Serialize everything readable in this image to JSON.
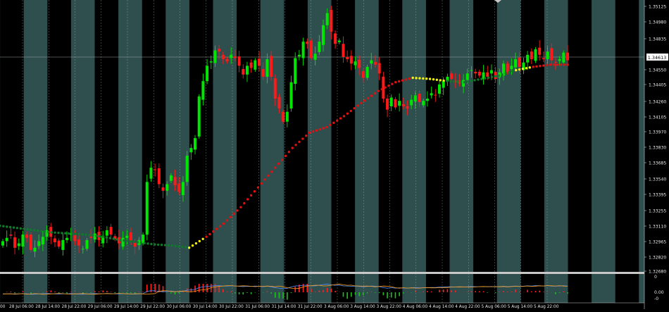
{
  "chart_data": [
    {
      "type": "candlestick",
      "panel": "price",
      "session_background_colors": [
        "#000000",
        "#2f4f4f"
      ],
      "up_color": "#00e600",
      "down_color": "#ff1a1a",
      "current_price": "1.34613",
      "y_ticks": [
        "1.35125",
        "1.34980",
        "1.34835",
        "1.34550",
        "1.34405",
        "1.34260",
        "1.34105",
        "1.33970",
        "1.33830",
        "1.33685",
        "1.33540",
        "1.33395",
        "1.33255",
        "1.33110",
        "1.32965",
        "1.32820",
        "1.32680"
      ],
      "ylim": [
        1.3268,
        1.3516
      ],
      "x_ticks": [
        "28 Jul 06:00",
        "28 Jul 14:00",
        "28 Jul 22:00",
        "29 Jul 06:00",
        "29 Jul 14:00",
        "29 Jul 22:00",
        "30 Jul 06:00",
        "30 Jul 14:00",
        "30 Jul 22:00",
        "31 Jul 06:00",
        "31 Jul 14:00",
        "31 Jul 22:00",
        "3 Aug 06:00",
        "3 Aug 14:00",
        "3 Aug 22:00",
        "4 Aug 06:00",
        "4 Aug 14:00",
        "4 Aug 22:00",
        "5 Aug 06:00",
        "5 Aug 14:00",
        "5 Aug 22:00"
      ],
      "x_tick_start_label": "00",
      "close_series": [
        1.3296,
        1.3299,
        1.3301,
        1.329,
        1.3294,
        1.3302,
        1.3299,
        1.3288,
        1.329,
        1.3296,
        1.33,
        1.3306,
        1.33,
        1.3295,
        1.3291,
        1.3297,
        1.3299,
        1.3303,
        1.3296,
        1.3292,
        1.3289,
        1.3297,
        1.3299,
        1.3303,
        1.3297,
        1.3301,
        1.3306,
        1.3302,
        1.3298,
        1.3294,
        1.3299,
        1.3301,
        1.3296,
        1.3291,
        1.3297,
        1.3302,
        1.335,
        1.3363,
        1.3361,
        1.3348,
        1.3342,
        1.3348,
        1.3356,
        1.3347,
        1.3341,
        1.335,
        1.3374,
        1.3381,
        1.339,
        1.3428,
        1.3442,
        1.3456,
        1.346,
        1.347,
        1.3469,
        1.3462,
        1.346,
        1.3466,
        1.3463,
        1.3456,
        1.3448,
        1.3456,
        1.3454,
        1.3461,
        1.3456,
        1.3446,
        1.3462,
        1.3446,
        1.3426,
        1.3417,
        1.3405,
        1.3414,
        1.3441,
        1.3463,
        1.3466,
        1.3478,
        1.3476,
        1.3463,
        1.3467,
        1.3478,
        1.3493,
        1.3504,
        1.3487,
        1.3476,
        1.3479,
        1.3464,
        1.3462,
        1.3458,
        1.346,
        1.3454,
        1.3445,
        1.3455,
        1.3461,
        1.3457,
        1.3449,
        1.3426,
        1.3416,
        1.3427,
        1.3418,
        1.3424,
        1.3419,
        1.3417,
        1.3425,
        1.3429,
        1.3423,
        1.3424,
        1.3426,
        1.3431,
        1.3429,
        1.3439,
        1.3442,
        1.3446,
        1.3444,
        1.3441,
        1.344,
        1.3443,
        1.3449,
        1.3452,
        1.3449,
        1.3447,
        1.345,
        1.3446,
        1.3452,
        1.3444,
        1.345,
        1.3458,
        1.345,
        1.3456,
        1.3462,
        1.3455,
        1.3459,
        1.3466,
        1.3462,
        1.3471,
        1.3466,
        1.3462,
        1.3469,
        1.3461,
        1.3459,
        1.3462,
        1.3468,
        1.3461
      ],
      "trend_series": [
        1.331,
        1.3308,
        1.3306,
        1.3304,
        1.3303,
        1.3302,
        1.33,
        1.3297,
        1.3295,
        1.3293,
        1.3292,
        1.329,
        1.33,
        1.3312,
        1.3327,
        1.3345,
        1.3363,
        1.3381,
        1.3395,
        1.34,
        1.341,
        1.3422,
        1.3433,
        1.3441,
        1.3445,
        1.3444,
        1.3442,
        1.3441,
        1.3444,
        1.3447,
        1.3452,
        1.3455,
        1.3457,
        1.3457
      ],
      "trend_colors_note": "bull phase red, bear phase green, neutral yellow"
    },
    {
      "type": "macd",
      "panel": "oscillator",
      "y_ticks": [
        "0",
        "0.00",
        "-0"
      ],
      "main_line_color": "#4f8fff",
      "signal_line_color": "#ff9f1a",
      "histogram_up_color": "#ff2020",
      "histogram_down_color": "#20c020"
    }
  ]
}
